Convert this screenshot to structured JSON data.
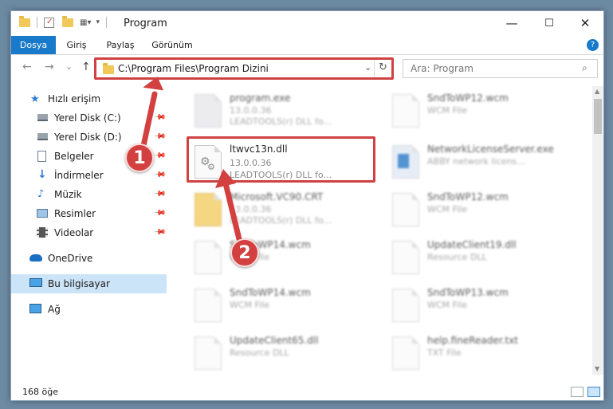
{
  "window": {
    "title": "Program",
    "controls": {
      "minimize": "—",
      "maximize": "☐",
      "close": "✕"
    }
  },
  "ribbon": {
    "tabs": [
      {
        "label": "Dosya",
        "active": true
      },
      {
        "label": "Giriş"
      },
      {
        "label": "Paylaş"
      },
      {
        "label": "Görünüm"
      }
    ],
    "help": "?"
  },
  "nav": {
    "back": "←",
    "forward": "→",
    "recent": "⌄",
    "up": "↑",
    "address": "C:\\Program Files\\Program Dizini",
    "search_placeholder": "Ara: Program"
  },
  "sidebar": {
    "items": [
      {
        "label": "Hızlı erişim",
        "icon": "star-icon"
      },
      {
        "label": "Yerel Disk (C:)",
        "icon": "drive-icon",
        "pinned": true
      },
      {
        "label": "Yerel Disk (D:)",
        "icon": "drive-icon",
        "pinned": true
      },
      {
        "label": "Belgeler",
        "icon": "documents-icon",
        "pinned": true
      },
      {
        "label": "İndirmeler",
        "icon": "download-icon",
        "pinned": true
      },
      {
        "label": "Müzik",
        "icon": "music-icon",
        "pinned": true
      },
      {
        "label": "Resimler",
        "icon": "pictures-icon",
        "pinned": true
      },
      {
        "label": "Videolar",
        "icon": "videos-icon",
        "pinned": true
      },
      {
        "label": "OneDrive",
        "icon": "cloud-icon"
      },
      {
        "label": "Bu bilgisayar",
        "icon": "computer-icon",
        "selected": true
      },
      {
        "label": "Ağ",
        "icon": "network-icon"
      }
    ]
  },
  "files": {
    "left": [
      {
        "name": "program.exe",
        "line2": "13.0.0.36",
        "line3": "LEADTOOLS(r) DLL fo..."
      },
      {
        "name": "ltwvc13n.dll",
        "line2": "13.0.0.36",
        "line3": "LEADTOOLS(r) DLL fo...",
        "highlighted": true
      },
      {
        "name": "Microsoft.VC90.CRT",
        "line2": "13.0.0.36",
        "line3": "LEADTOOLS(r) DLL fo..."
      },
      {
        "name": "SndToWP14.wcm",
        "line2": "WCM File",
        "line3": ""
      },
      {
        "name": "SndToWP14.wcm",
        "line2": "WCM File",
        "line3": ""
      },
      {
        "name": "UpdateClient65.dll",
        "line2": "Resource DLL",
        "line3": ""
      }
    ],
    "right": [
      {
        "name": "SndToWP12.wcm",
        "line2": "WCM File"
      },
      {
        "name": "NetworkLicenseServer.exe",
        "line2": "ABBY network licens..."
      },
      {
        "name": "SndToWP12.wcm",
        "line2": "WCM File"
      },
      {
        "name": "UpdateClient19.dll",
        "line2": "Resource DLL"
      },
      {
        "name": "SndToWP13.wcm",
        "line2": "WCM File"
      },
      {
        "name": "help.fineReader.txt",
        "line2": "TXT File"
      }
    ]
  },
  "status": {
    "count": "168 öğe"
  },
  "annotations": {
    "marker1": "1",
    "marker2": "2"
  },
  "colors": {
    "accent": "#1979ca",
    "highlight": "#d04242",
    "selected": "#cce4f7"
  }
}
